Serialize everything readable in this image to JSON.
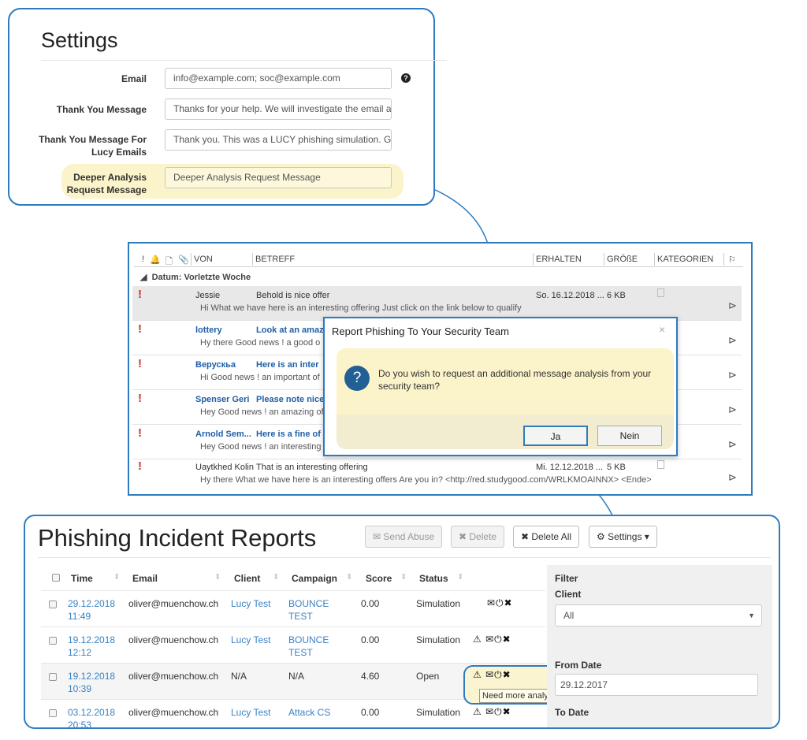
{
  "settings": {
    "title": "Settings",
    "email_label": "Email",
    "email_value": "info@example.com; soc@example.com",
    "thank_label": "Thank You Message",
    "thank_value": "Thanks for your help. We will investigate the email anc",
    "thank_lucy_label_1": "Thank You Message For",
    "thank_lucy_label_2": "Lucy Emails",
    "thank_lucy_value": "Thank you. This was a LUCY phishing simulation. Goo",
    "deeper_label_1": "Deeper Analysis",
    "deeper_label_2": "Request Message",
    "deeper_value": "Deeper Analysis Request Message",
    "help_icon": "question-circle-icon"
  },
  "mail": {
    "columns": {
      "from": "VON",
      "subject": "BETREFF",
      "received": "ERHALTEN",
      "size": "GRÖßE",
      "categories": "KATEGORIEN"
    },
    "group": "Datum: Vorletzte Woche",
    "rows": [
      {
        "from": "Jessie",
        "subject": "Behold is  nice offer",
        "preview": "Hi What we have here is an interesting offering Just click on the link below to qualify",
        "date": "So. 16.12.2018 ...",
        "size": "6 KB"
      },
      {
        "from": "lottery",
        "subject": "Look at an amaz",
        "preview": "Hy there Good news ! a good o",
        "date": "",
        "size": ""
      },
      {
        "from": "Верускьа",
        "subject": "Here is  an inter",
        "preview": "Hi Good news ! an important of",
        "date": "",
        "size": ""
      },
      {
        "from": "Spenser Geri",
        "subject": "Please note nice",
        "preview": "Hey Good news ! an amazing of",
        "date": "",
        "size": ""
      },
      {
        "from": "Arnold Sem...",
        "subject": "Here is  a fine of",
        "preview": "Hey Good news ! an interesting",
        "date": "",
        "size": ""
      },
      {
        "from": "Uaytkhed Kolin",
        "subject": "That is an interesting offering",
        "preview": "Hy there What we have here is an interesting offers Are you in? <http://red.studygood.com/WRLKMOAINNX>  <Ende>",
        "date": "Mi. 12.12.2018 ...",
        "size": "5 KB"
      }
    ]
  },
  "dialog": {
    "title": "Report Phishing To Your Security Team",
    "close": "×",
    "question_icon": "?",
    "message": "Do you wish to request an additional message analysis from your security team?",
    "yes": "Ja",
    "no": "Nein"
  },
  "reports": {
    "title": "Phishing Incident Reports",
    "send_abuse": "✉ Send Abuse",
    "delete": "✖ Delete",
    "delete_all": "✖ Delete All",
    "settings": "⚙ Settings ▾",
    "headers": {
      "time": "Time",
      "email": "Email",
      "client": "Client",
      "campaign": "Campaign",
      "score": "Score",
      "status": "Status"
    },
    "rows": [
      {
        "time1": "29.12.2018",
        "time2": "11:49",
        "email": "oliver@muenchow.ch",
        "client": "Lucy Test",
        "campaign1": "BOUNCE",
        "campaign2": "TEST",
        "score": "0.00",
        "status": "Simulation",
        "actions": "✉⏻✖"
      },
      {
        "time1": "19.12.2018",
        "time2": "12:12",
        "email": "oliver@muenchow.ch",
        "client": "Lucy Test",
        "campaign1": "BOUNCE",
        "campaign2": "TEST",
        "score": "0.00",
        "status": "Simulation",
        "actions": "⚠ ✉⏻✖"
      },
      {
        "time1": "19.12.2018",
        "time2": "10:39",
        "email": "oliver@muenchow.ch",
        "client": "N/A",
        "campaign1": "N/A",
        "campaign2": "",
        "score": "4.60",
        "status": "Open",
        "actions": "⚠ ✉⏻✖"
      },
      {
        "time1": "03.12.2018",
        "time2": "20:53",
        "email": "oliver@muenchow.ch",
        "client": "Lucy Test",
        "campaign1": "Attack CS",
        "campaign2": "",
        "score": "0.00",
        "status": "Simulation",
        "actions": "⚠ ✉⏻✖"
      }
    ],
    "tooltip": "Need more analysis",
    "filter": {
      "title": "Filter",
      "client_label": "Client",
      "client_value": "All",
      "from_label": "From Date",
      "from_value": "29.12.2017",
      "to_label": "To Date"
    }
  }
}
